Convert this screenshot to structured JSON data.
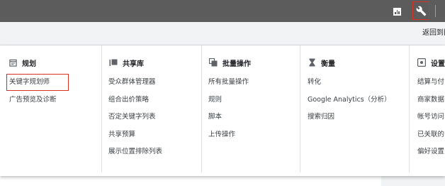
{
  "toolbar": {
    "reports_icon": "bar-chart-icon",
    "tools_icon": "wrench-icon"
  },
  "subheader": {
    "return_link": "返回到旧"
  },
  "menu": {
    "planning": {
      "title": "规划",
      "icon": "calendar-icon",
      "items": [
        "关键字规划师",
        "广告预览及诊断"
      ]
    },
    "shared_library": {
      "title": "共享库",
      "icon": "library-icon",
      "items": [
        "受众群体管理器",
        "组合出价策略",
        "否定关键字列表",
        "共享预算",
        "展示位置排除列表"
      ]
    },
    "bulk_actions": {
      "title": "批量操作",
      "icon": "copy-icon",
      "items": [
        "所有批量操作",
        "规则",
        "脚本",
        "上传操作"
      ]
    },
    "measurement": {
      "title": "衡量",
      "icon": "hourglass-icon",
      "items": [
        "转化",
        "Google Analytics（分析）",
        "搜索归因"
      ]
    },
    "setup": {
      "title": "设置",
      "icon": "settings-icon",
      "items": [
        "结算与付",
        "商家数据",
        "帐号访问",
        "已关联的",
        "偏好设置"
      ]
    }
  }
}
